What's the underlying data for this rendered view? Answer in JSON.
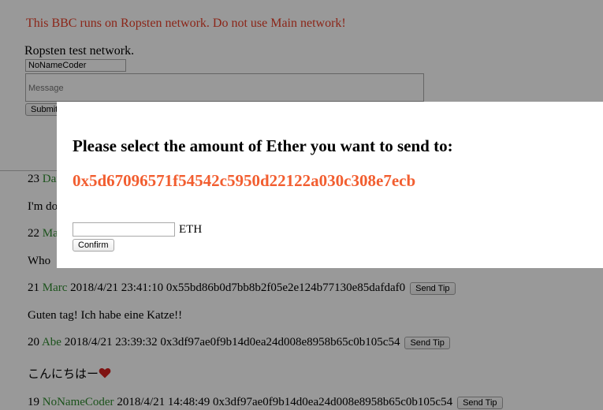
{
  "header": {
    "warning": "This BBC runs on Ropsten network. Do not use Main network!",
    "network_status": "Ropsten test network."
  },
  "form": {
    "name_value": "NoNameCoder",
    "message_placeholder": "Message",
    "submit_label": "Submit"
  },
  "posts": [
    {
      "number": "23",
      "author": "Dan",
      "timestamp": "",
      "address": "",
      "body": "I'm do"
    },
    {
      "number": "22",
      "author": "Ma",
      "timestamp": "",
      "address": "",
      "body": "Who"
    },
    {
      "number": "21",
      "author": "Marc",
      "timestamp": "2018/4/21 23:41:10",
      "address": "0x55bd86b0d7bb8b2f05e2e124b77130e85dafdaf0",
      "body": "Guten tag! Ich habe eine Katze!!"
    },
    {
      "number": "20",
      "author": "Abe",
      "timestamp": "2018/4/21 23:39:32",
      "address": "0x3df97ae0f9b14d0ea24d008e8958b65c0b105c54",
      "body": "こんにちはー"
    },
    {
      "number": "19",
      "author": "NoNameCoder",
      "timestamp": "2018/4/21 14:48:49",
      "address": "0x3df97ae0f9b14d0ea24d008e8958b65c0b105c54",
      "body": ""
    }
  ],
  "tip_button_label": "Send Tip",
  "heart_icon": "heart-icon",
  "modal": {
    "title": "Please select the amount of Ether you want to send to:",
    "recipient_address": "0x5d67096571f54542c5950d22122a030c308e7ecb",
    "amount_value": "",
    "unit": "ETH",
    "confirm_label": "Confirm"
  },
  "colors": {
    "warning": "#e8402a",
    "author": "#2f8a2f",
    "address_highlight": "#f25e30",
    "overlay": "rgba(0,0,0,0.4)"
  }
}
